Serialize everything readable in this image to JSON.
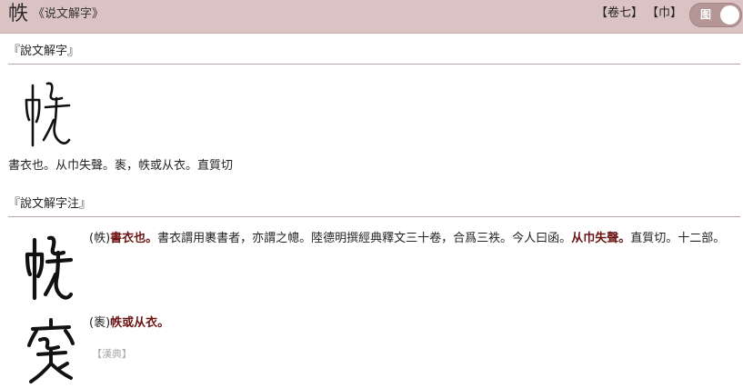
{
  "header": {
    "character": "帙",
    "book": "《说文解字》",
    "volume_tag": "【卷七】",
    "radical_tag": "【巾】",
    "toggle_label": "图"
  },
  "shuowen": {
    "heading": "『說文解字』",
    "seal_icon": "seal-script-zhi-icon",
    "definition": "書衣也。从巾失聲。袠，帙或从衣。直質切"
  },
  "zhu": {
    "heading": "『說文解字注』",
    "entries": [
      {
        "seal_icon": "seal-script-zhi-icon",
        "prefix": "(帙)",
        "bold1": "書衣也。",
        "mid": "書衣謂用裹書者，亦謂之幒。陸德明撰經典釋文三十卷，合爲三袟。今人曰函。",
        "bold2": "从巾失聲。",
        "tail": "直質切。十二部。"
      },
      {
        "seal_icon": "seal-script-zhi-variant-icon",
        "prefix": "(袠)",
        "bold1": "帙或从衣。"
      }
    ],
    "source_link": "【漢典】"
  }
}
